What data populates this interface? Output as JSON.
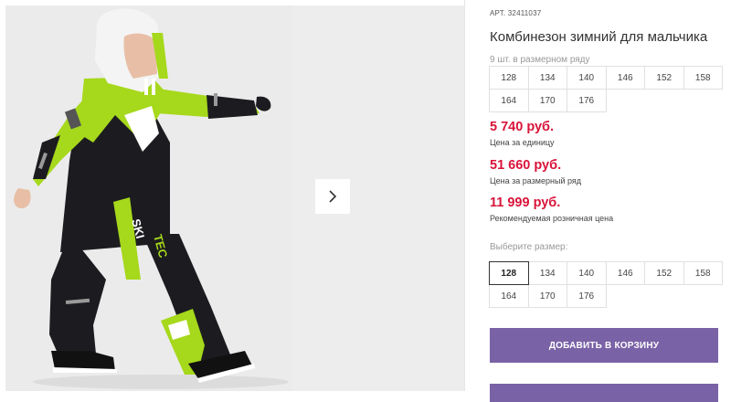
{
  "product": {
    "sku_label": "АРТ.",
    "sku_value": "32411037",
    "title": "Комбинезон зимний для мальчика",
    "set_caption": "9 шт. в размерном ряду",
    "set_sizes": [
      "128",
      "134",
      "140",
      "146",
      "152",
      "158",
      "164",
      "170",
      "176"
    ],
    "prices": [
      {
        "value": "5 740 руб.",
        "label": "Цена за единицу"
      },
      {
        "value": "51 660 руб.",
        "label": "Цена за размерный ряд"
      },
      {
        "value": "11 999 руб.",
        "label": "Рекомендуемая розничная цена"
      }
    ],
    "choose_caption": "Выберите размер:",
    "choose_sizes": [
      "128",
      "134",
      "140",
      "146",
      "152",
      "158",
      "164",
      "170",
      "176"
    ],
    "selected_size": "128",
    "add_to_cart": "ДОБАВИТЬ В КОРЗИНУ"
  },
  "gallery": {
    "print_text_1": "SKI",
    "print_text_2": "TEC",
    "next_icon": "chevron-right-icon"
  },
  "colors": {
    "accent": "#7a62a6",
    "price": "#d9143a",
    "lime": "#a6d81b",
    "suit_dark": "#1c1c20"
  }
}
